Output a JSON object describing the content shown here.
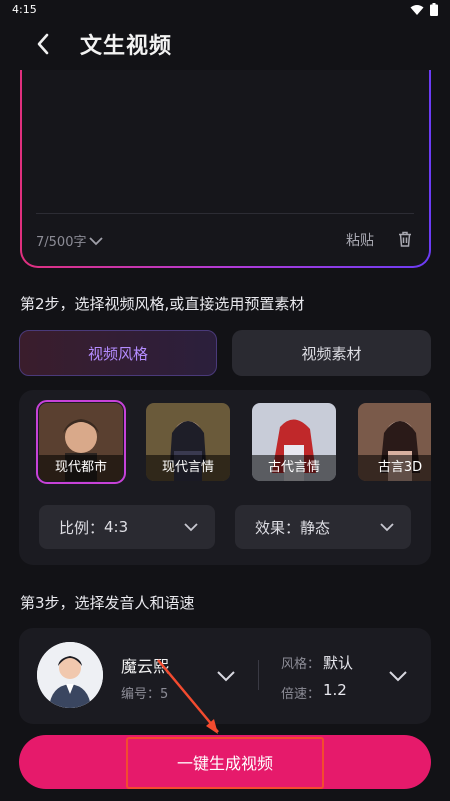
{
  "status_bar": {
    "time": "4:15"
  },
  "header": {
    "title": "文生视频"
  },
  "text_input": {
    "char_count": "7/500字",
    "paste_label": "粘贴"
  },
  "step2": {
    "label": "第2步，选择视频风格,或直接选用预置素材",
    "tabs": [
      {
        "label": "视频风格",
        "active": true
      },
      {
        "label": "视频素材",
        "active": false
      }
    ],
    "styles": [
      {
        "label": "现代都市",
        "selected": true
      },
      {
        "label": "现代言情",
        "selected": false
      },
      {
        "label": "古代言情",
        "selected": false
      },
      {
        "label": "古言3D",
        "selected": false
      }
    ],
    "ratio": {
      "label": "比例：",
      "value": "4:3"
    },
    "effect": {
      "label": "效果：",
      "value": "静态"
    }
  },
  "step3": {
    "label": "第3步，选择发音人和语速",
    "voice": {
      "name": "魔云熙",
      "id_label": "编号：",
      "id_value": "5"
    },
    "style": {
      "label": "风格：",
      "value": "默认"
    },
    "speed": {
      "label": "倍速：",
      "value": "1.2"
    }
  },
  "generate_button": {
    "label": "一键生成视频"
  },
  "colors": {
    "accent": "#e61a6b",
    "selected_style_outline": "#c742d8",
    "annotation": "#f34b2f"
  }
}
